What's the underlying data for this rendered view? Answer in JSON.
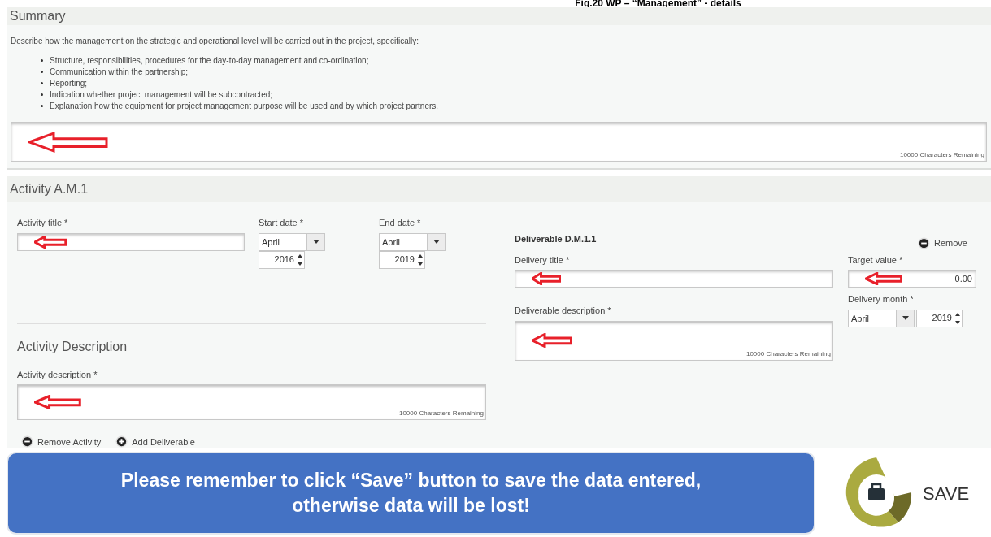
{
  "caption": "Fig.20 WP – “Management” - details",
  "summary": {
    "title": "Summary",
    "intro": "Describe how the management on the strategic and operational level will be carried out in the project, specifically:",
    "bullets": [
      "Structure, responsibilities, procedures for the day-to-day management and co-ordination;",
      "Communication within the partnership;",
      "Reporting;",
      "Indication whether project management will be subcontracted;",
      "Explanation how the equipment for project management purpose will be used and by which project partners."
    ],
    "counter": "10000 Characters Remaining"
  },
  "activity": {
    "title": "Activity A.M.1",
    "title_label": "Activity title *",
    "start": {
      "label": "Start date *",
      "month": "April",
      "year": "2016"
    },
    "end": {
      "label": "End date *",
      "month": "April",
      "year": "2019"
    },
    "description_heading": "Activity Description",
    "description_label": "Activity description *",
    "counter": "10000 Characters Remaining",
    "actions": [
      {
        "kind": "remove",
        "label": "Remove Activity"
      },
      {
        "kind": "add",
        "label": "Add Deliverable"
      }
    ]
  },
  "deliverable": {
    "title": "Deliverable D.M.1.1",
    "remove": "Remove",
    "title_label": "Delivery title *",
    "target_label": "Target value *",
    "target_value": "0.00",
    "month_label": "Delivery month *",
    "month": "April",
    "year": "2019",
    "description_label": "Deliverable description *",
    "counter": "10000 Characters Remaining"
  },
  "notice": {
    "line1": "Please remember to click “Save” button to save the data entered,",
    "line2": "otherwise data will be lost!"
  },
  "save": {
    "label": "SAVE"
  }
}
